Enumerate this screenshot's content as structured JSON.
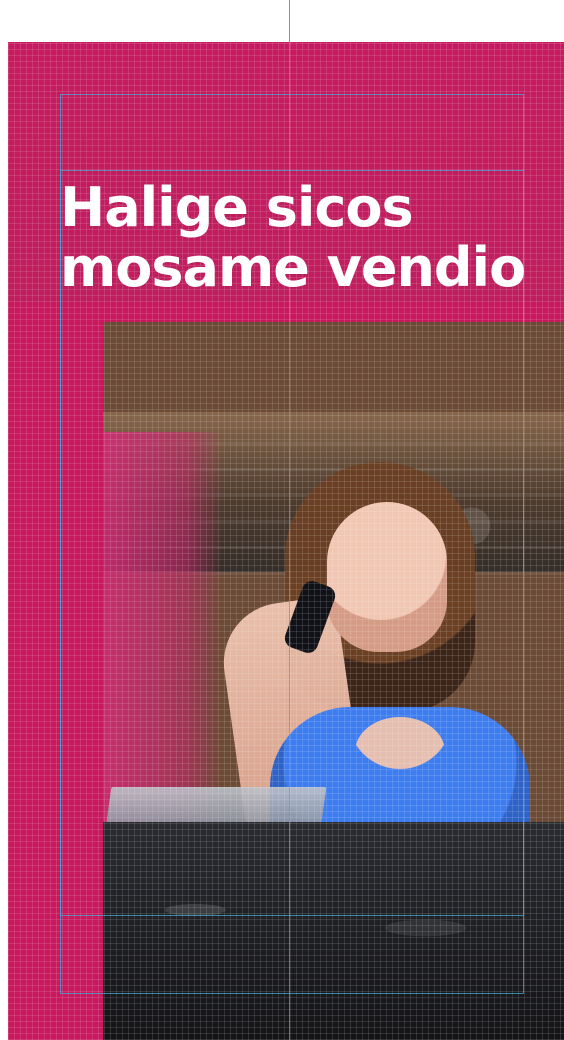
{
  "headline": {
    "line1": "Halige sicos",
    "line2": "mosame vendio"
  },
  "colors": {
    "brand_magenta": "#c8195f",
    "guide_blue": "#3fa7d6",
    "top_blue": "#3d7df0"
  },
  "icons": {
    "guides": "layout-guides-icon"
  }
}
